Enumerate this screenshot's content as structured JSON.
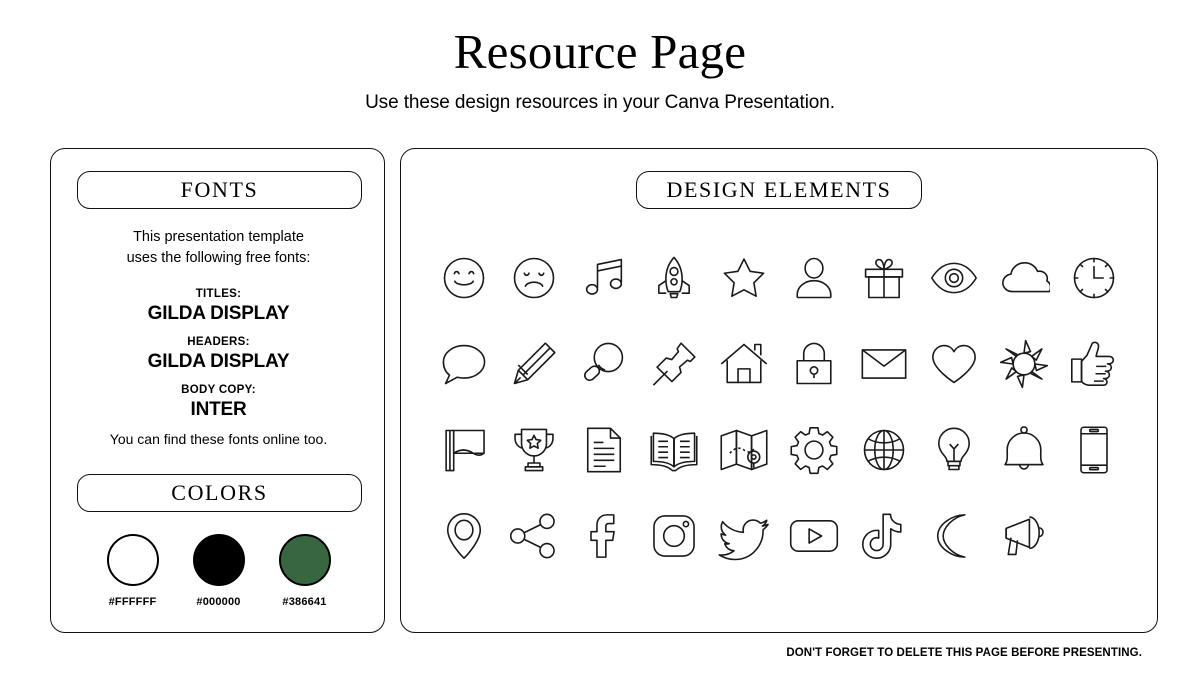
{
  "header": {
    "title": "Resource Page",
    "subtitle": "Use these design resources in your Canva Presentation."
  },
  "fonts_panel": {
    "heading": "FONTS",
    "intro": "This presentation template\nuses the following free fonts:",
    "groups": [
      {
        "role": "TITLES:",
        "name": "GILDA DISPLAY"
      },
      {
        "role": "HEADERS:",
        "name": "GILDA DISPLAY"
      },
      {
        "role": "BODY COPY:",
        "name": "INTER"
      }
    ],
    "outro": "You can find these fonts online too."
  },
  "colors_panel": {
    "heading": "COLORS",
    "swatches": [
      {
        "hex": "#FFFFFF",
        "label": "#FFFFFF"
      },
      {
        "hex": "#000000",
        "label": "#000000"
      },
      {
        "hex": "#386641",
        "label": "#386641"
      }
    ]
  },
  "design_panel": {
    "heading": "DESIGN ELEMENTS",
    "icons": [
      "smiley-face-icon",
      "sad-face-icon",
      "music-note-icon",
      "rocket-icon",
      "star-icon",
      "person-icon",
      "gift-icon",
      "eye-icon",
      "cloud-icon",
      "clock-icon",
      "speech-bubble-icon",
      "pencil-icon",
      "magnifying-glass-icon",
      "pushpin-icon",
      "house-icon",
      "lock-icon",
      "envelope-icon",
      "heart-icon",
      "sun-icon",
      "thumbs-up-icon",
      "flag-icon",
      "trophy-icon",
      "document-icon",
      "open-book-icon",
      "map-icon",
      "gear-icon",
      "globe-icon",
      "lightbulb-icon",
      "bell-icon",
      "phone-icon",
      "location-pin-icon",
      "share-icon",
      "facebook-icon",
      "instagram-icon",
      "twitter-icon",
      "youtube-icon",
      "tiktok-icon",
      "moon-icon",
      "megaphone-icon"
    ]
  },
  "footer": {
    "note": "DON'T FORGET TO DELETE THIS PAGE BEFORE PRESENTING."
  }
}
